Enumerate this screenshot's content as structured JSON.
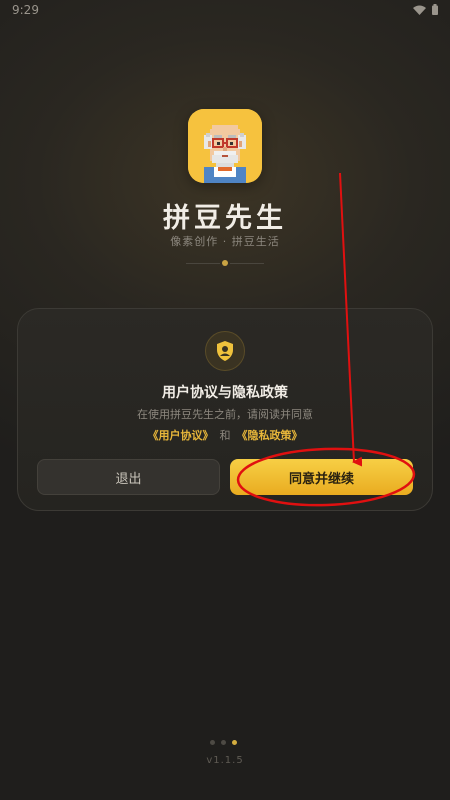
{
  "status_bar": {
    "time": "9:29"
  },
  "app": {
    "title": "拼豆先生",
    "subtitle": "像素创作 · 拼豆生活"
  },
  "consent": {
    "title": "用户协议与隐私政策",
    "description": "在使用拼豆先生之前，请阅读并同意",
    "user_agreement_link": "《用户协议》",
    "and_text": "和",
    "privacy_policy_link": "《隐私政策》",
    "exit_label": "退出",
    "agree_label": "同意并继续"
  },
  "pager": {
    "count": 3,
    "active_index": 2
  },
  "version": "v1.1.5",
  "colors": {
    "accent": "#f4c23a",
    "background": "#1f1e1c",
    "annotation": "#e01010"
  }
}
